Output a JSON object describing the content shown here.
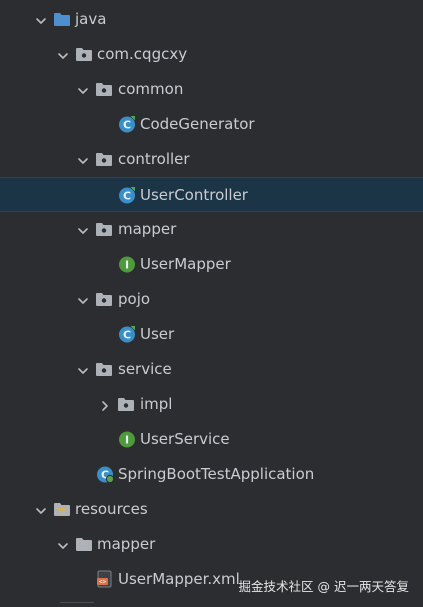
{
  "tree": [
    {
      "label": "java",
      "depth": 0,
      "arrow": "down",
      "icon": "source-folder-icon"
    },
    {
      "label": "com.cqgcxy",
      "depth": 1,
      "arrow": "down",
      "icon": "package-icon"
    },
    {
      "label": "common",
      "depth": 2,
      "arrow": "down",
      "icon": "package-icon"
    },
    {
      "label": "CodeGenerator",
      "depth": 3,
      "arrow": "none",
      "icon": "class-icon"
    },
    {
      "label": "controller",
      "depth": 2,
      "arrow": "down",
      "icon": "package-icon"
    },
    {
      "label": "UserController",
      "depth": 3,
      "arrow": "none",
      "icon": "class-icon",
      "selected": true
    },
    {
      "label": "mapper",
      "depth": 2,
      "arrow": "down",
      "icon": "package-icon"
    },
    {
      "label": "UserMapper",
      "depth": 3,
      "arrow": "none",
      "icon": "interface-icon"
    },
    {
      "label": "pojo",
      "depth": 2,
      "arrow": "down",
      "icon": "package-icon"
    },
    {
      "label": "User",
      "depth": 3,
      "arrow": "none",
      "icon": "class-icon"
    },
    {
      "label": "service",
      "depth": 2,
      "arrow": "down",
      "icon": "package-icon"
    },
    {
      "label": "impl",
      "depth": 3,
      "arrow": "right",
      "icon": "package-icon"
    },
    {
      "label": "UserService",
      "depth": 3,
      "arrow": "none",
      "icon": "interface-icon"
    },
    {
      "label": "SpringBootTestApplication",
      "depth": 2,
      "arrow": "none",
      "icon": "spring-app-icon"
    },
    {
      "label": "resources",
      "depth": 0,
      "arrow": "down",
      "icon": "resources-folder-icon"
    },
    {
      "label": "mapper",
      "depth": 1,
      "arrow": "down",
      "icon": "plain-folder-icon"
    },
    {
      "label": "UserMapper.xml",
      "depth": 2,
      "arrow": "none",
      "icon": "xml-file-icon"
    }
  ],
  "watermark": "掘金技术社区 @ 迟一两天答复",
  "colors": {
    "background": "#2b2d30",
    "selection": "#1b3446",
    "text": "#c9ccd1",
    "class_icon": "#3a8fc8",
    "interface_icon": "#4f9a3a",
    "folder_icon": "#adb2b8",
    "source_folder_icon": "#4d8fcf"
  }
}
